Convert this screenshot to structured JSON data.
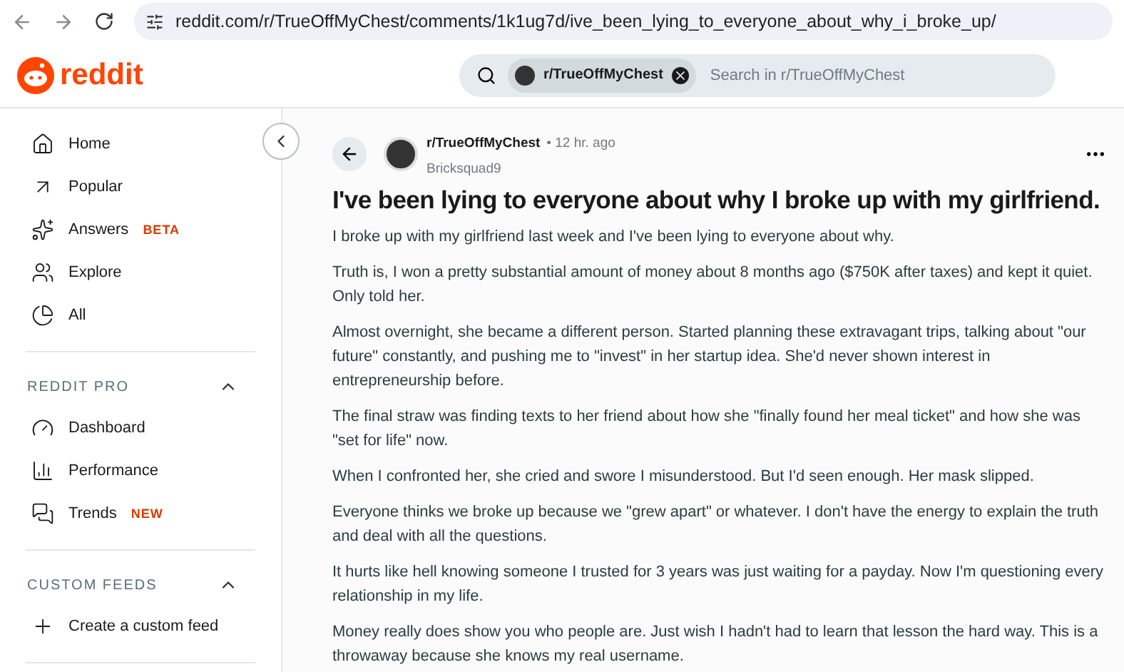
{
  "browser": {
    "url": "reddit.com/r/TrueOffMyChest/comments/1k1ug7d/ive_been_lying_to_everyone_about_why_i_broke_up/"
  },
  "header": {
    "logo": "reddit",
    "search": {
      "chip": "r/TrueOffMyChest",
      "placeholder": "Search in r/TrueOffMyChest"
    }
  },
  "sidebar": {
    "items": [
      {
        "label": "Home"
      },
      {
        "label": "Popular"
      },
      {
        "label": "Answers",
        "badge": "BETA"
      },
      {
        "label": "Explore"
      },
      {
        "label": "All"
      }
    ],
    "sections": [
      {
        "title": "REDDIT PRO",
        "expanded": true,
        "items": [
          {
            "label": "Dashboard"
          },
          {
            "label": "Performance"
          },
          {
            "label": "Trends",
            "badge": "NEW"
          }
        ]
      },
      {
        "title": "CUSTOM FEEDS",
        "expanded": true,
        "items": [
          {
            "label": "Create a custom feed"
          }
        ]
      }
    ]
  },
  "post": {
    "subreddit": "r/TrueOffMyChest",
    "time": "• 12 hr. ago",
    "author": "Bricksquad9",
    "title": "I've been lying to everyone about why I broke up with my girlfriend.",
    "paragraphs": [
      "I broke up with my girlfriend last week and I've been lying to everyone about why.",
      "Truth is, I won a pretty substantial amount of money about 8 months ago ($750K after taxes) and kept it quiet. Only told her.",
      "Almost overnight, she became a different person. Started planning these extravagant trips, talking about \"our future\" constantly, and pushing me to \"invest\" in her startup idea. She'd never shown interest in entrepreneurship before.",
      "The final straw was finding texts to her friend about how she \"finally found her meal ticket\" and how she was \"set for life\" now.",
      "When I confronted her, she cried and swore I misunderstood. But I'd seen enough. Her mask slipped.",
      "Everyone thinks we broke up because we \"grew apart\" or whatever. I don't have the energy to explain the truth and deal with all the questions.",
      "It hurts like hell knowing someone I trusted for 3 years was just waiting for a payday. Now I'm questioning every relationship in my life.",
      "Money really does show you who people are. Just wish I hadn't had to learn that lesson the hard way. This is a throwaway because she knows my real username."
    ]
  }
}
